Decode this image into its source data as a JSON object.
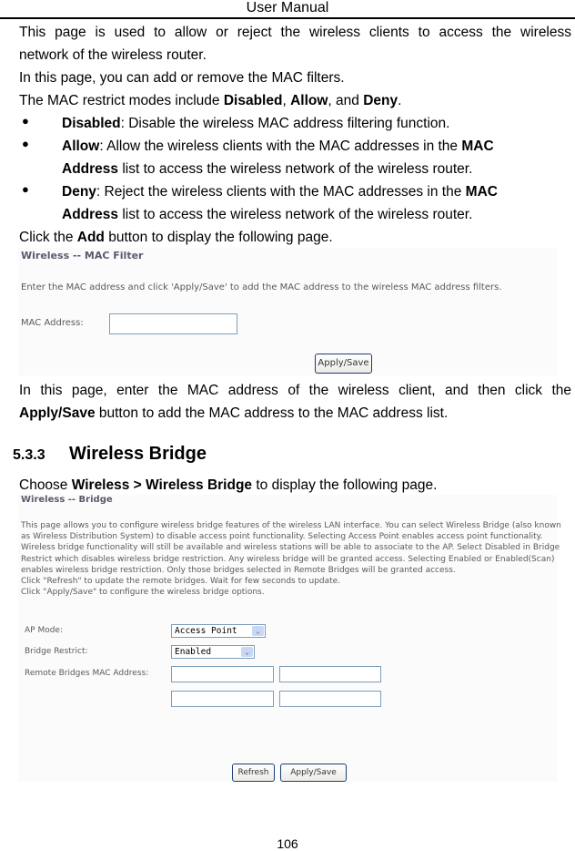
{
  "header": {
    "title": "User Manual"
  },
  "intro": {
    "p1": "This page is used to allow or reject the wireless clients to access the wireless",
    "p1b": "network of the wireless router.",
    "p2": "In this page, you can add or remove the MAC filters.",
    "p3_pre": "The MAC restrict modes include ",
    "p3_b1": "Disabled",
    "p3_sep1": ", ",
    "p3_b2": "Allow",
    "p3_sep2": ", and ",
    "p3_b3": "Deny",
    "p3_end": "."
  },
  "bullets": [
    {
      "term": "Disabled",
      "text": ": Disable the wireless MAC address filtering function."
    },
    {
      "term": "Allow",
      "text": ": Allow the wireless clients with the MAC addresses in the ",
      "bold2": "MAC",
      "line2_bold": "Address",
      "line2": " list to access the wireless network of the wireless router."
    },
    {
      "term": "Deny",
      "text": ": Reject the wireless clients with the MAC addresses in the ",
      "bold2": "MAC",
      "line2_bold": "Address",
      "line2": " list to access the wireless network of the wireless router."
    }
  ],
  "click_add": {
    "pre": "Click the ",
    "bold": "Add",
    "post": " button to display the following page."
  },
  "mac_filter": {
    "title": "Wireless -- MAC Filter",
    "instruction": "Enter the MAC address and click 'Apply/Save' to add the MAC address to the wireless MAC address filters.",
    "mac_label": "MAC Address:",
    "mac_value": "",
    "apply_label": "Apply/Save"
  },
  "after_mac": {
    "line1": "In this page, enter the MAC address of the wireless client, and then click the",
    "line2_bold": "Apply/Save",
    "line2": " button to add the MAC address to the MAC address list."
  },
  "section": {
    "number": "5.3.3",
    "title": "Wireless Bridge"
  },
  "choose": {
    "pre": "Choose ",
    "bold": "Wireless > Wireless Bridge",
    "post": " to display the following page."
  },
  "bridge": {
    "title": "Wireless -- Bridge",
    "desc": [
      "This page allows you to configure wireless bridge features of the wireless LAN interface. You can select Wireless Bridge (also known",
      "as Wireless Distribution System) to disable access point functionality. Selecting Access Point enables access point functionality.",
      "Wireless bridge functionality will still be available and wireless stations will be able to associate to the AP. Select Disabled in Bridge",
      "Restrict which disables wireless bridge restriction. Any wireless bridge will be granted access. Selecting Enabled or Enabled(Scan)",
      "enables wireless bridge restriction. Only those bridges selected in Remote Bridges will be granted access.",
      "Click \"Refresh\" to update the remote bridges. Wait for few seconds to update.",
      "Click \"Apply/Save\" to configure the wireless bridge options."
    ],
    "ap_mode_label": "AP Mode:",
    "ap_mode_value": "Access Point",
    "restrict_label": "Bridge Restrict:",
    "restrict_value": "Enabled",
    "remote_label": "Remote Bridges MAC Address:",
    "remote_values": [
      "",
      "",
      "",
      ""
    ],
    "refresh_label": "Refresh",
    "apply_label": "Apply/Save"
  },
  "footer": {
    "page_number": "106"
  }
}
